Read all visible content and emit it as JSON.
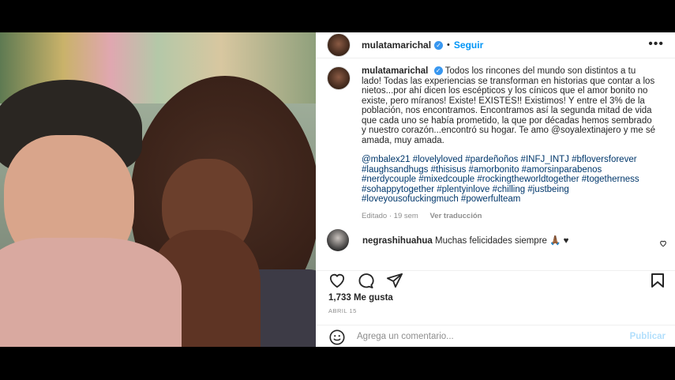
{
  "header": {
    "username": "mulatamarichal",
    "verified_mark": "✓",
    "separator": "•",
    "follow_label": "Seguir",
    "more_label": "•••"
  },
  "caption": {
    "username": "mulatamarichal",
    "text": "Todos los rincones del mundo son distintos a tu lado! Todas las experiencias se transforman en historias que contar a los nietos...por ahí dicen los escépticos y los cínicos que el amor bonito no existe, pero míranos! Existe! EXISTES!! Existimos! Y entre el 3% de la población, nos encontramos. Encontramos así la segunda mitad de vida que cada uno se había prometido, la que por décadas hemos sembrado y nuestro corazón...encontró su hogar. Te amo @soyalextinajero y me sé amada, muy amada.",
    "hashtags": "@mbalex21 #lovelyloved #pardeñoños #INFJ_INTJ #bfloversforever #laughsandhugs #thisisus #amorbonito #amorsinparabenos #nerdycouple #mixedcouple #rockingtheworldtogether #togetherness #sohappytogether #plentyinlove #chilling #justbeing #loveyousofuckingmuch #powerfulteam",
    "edited_label": "Editado · 19 sem",
    "translate_label": "Ver traducción"
  },
  "comment": {
    "username": "negrashihuahua",
    "text": "Muchas felicidades siempre 🙏🏾 ♥"
  },
  "stats": {
    "likes": "1,733 Me gusta",
    "date": "ABRIL 15"
  },
  "add_comment": {
    "placeholder": "Agrega un comentario...",
    "publish_label": "Publicar"
  },
  "icons": [
    "heart-icon",
    "comment-icon",
    "share-icon",
    "save-icon",
    "emoji-icon",
    "more-icon"
  ],
  "colors": {
    "link": "#00376b",
    "follow": "#0095f6",
    "publish_disabled": "#b2dffc",
    "muted": "#8e8e8e"
  }
}
